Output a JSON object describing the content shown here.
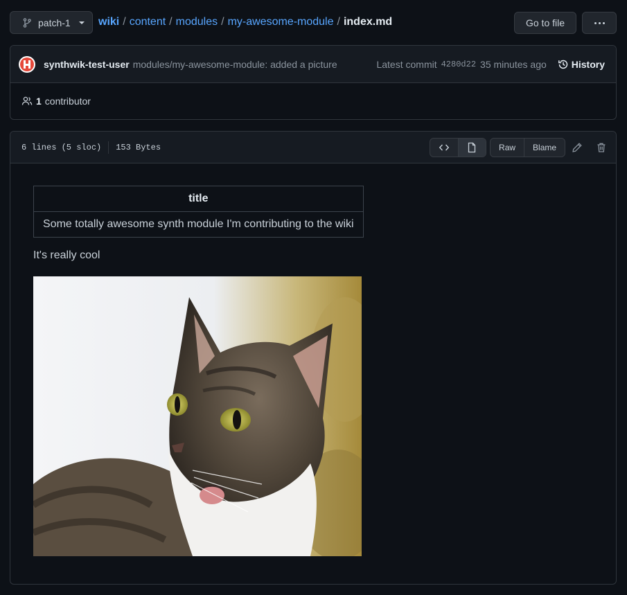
{
  "branch": {
    "name": "patch-1",
    "icon": "git-branch-icon"
  },
  "breadcrumb": {
    "items": [
      "wiki",
      "content",
      "modules",
      "my-awesome-module"
    ],
    "separator": "/",
    "current": "index.md"
  },
  "actions": {
    "go_to_file": "Go to file",
    "more_icon": "kebab-horizontal-icon"
  },
  "commit": {
    "author": "synthwik-test-user",
    "message": "modules/my-awesome-module: added a picture",
    "latest_label": "Latest commit",
    "sha": "4280d22",
    "time": "35 minutes ago",
    "history_label": "History"
  },
  "contributors": {
    "count": "1",
    "label": "contributor"
  },
  "file": {
    "lines": "6 lines (5 sloc)",
    "size": "153 Bytes",
    "raw_label": "Raw",
    "blame_label": "Blame"
  },
  "content": {
    "table": {
      "header": "title",
      "cell": "Some totally awesome synth module I'm contributing to the wiki"
    },
    "paragraph": "It's really cool",
    "image_subject": "tabby cat"
  },
  "colors": {
    "link": "#58a6ff",
    "background": "#0d1117",
    "panel": "#161b22",
    "border": "#30363d"
  }
}
